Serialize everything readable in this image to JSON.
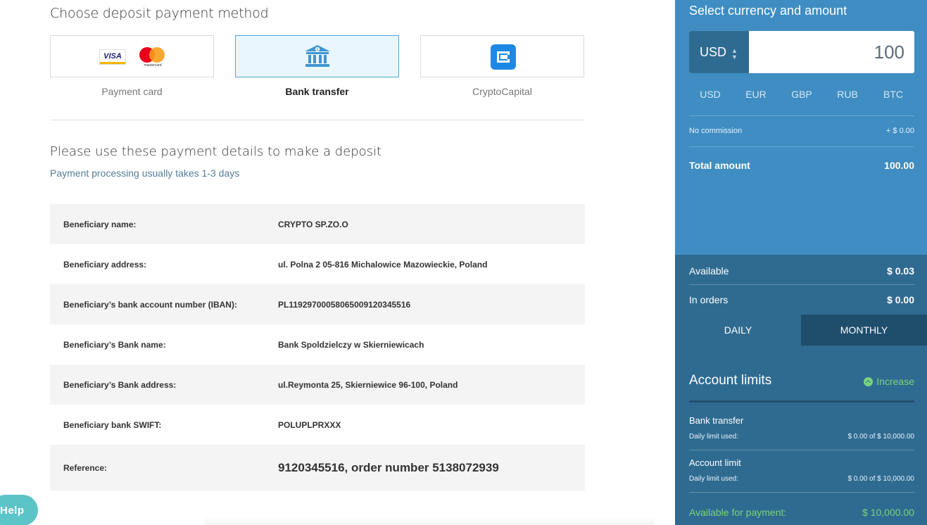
{
  "deposit": {
    "section_title": "Choose deposit payment method",
    "methods": [
      {
        "label": "Payment card",
        "icon": "card-brands-icon"
      },
      {
        "label": "Bank transfer",
        "icon": "bank-icon"
      },
      {
        "label": "CryptoCapital",
        "icon": "cryptocapital-icon"
      }
    ],
    "card_brands": {
      "visa": "VISA",
      "mastercard": "mastercard"
    },
    "selected_method": "Bank transfer"
  },
  "details": {
    "title": "Please use these payment details to make a deposit",
    "subtitle": "Payment processing usually takes 1-3 days",
    "rows": [
      {
        "key": "Beneficiary name:",
        "value": "CRYPTO SP.ZO.O"
      },
      {
        "key": "Beneficiary address:",
        "value": "ul. Polna 2 05-816 Michalowice Mazowieckie, Poland"
      },
      {
        "key": "Beneficiary’s bank account number (IBAN):",
        "value": "PL11929700058065009120345516"
      },
      {
        "key": "Beneficiary’s Bank name:",
        "value": "Bank Spoldzielczy w Skierniewicach"
      },
      {
        "key": "Beneficiary’s Bank address:",
        "value": "ul.Reymonta 25, Skierniewice 96-100, Poland"
      },
      {
        "key": "Beneficiary bank SWIFT:",
        "value": "POLUPLPRXXX"
      },
      {
        "key": "Reference:",
        "value": "9120345516, order number 5138072939"
      }
    ]
  },
  "help": {
    "label": "Help"
  },
  "sidebar": {
    "title": "Select currency and amount",
    "currency_select": "USD",
    "amount_value": "100",
    "currencies": [
      "USD",
      "EUR",
      "GBP",
      "RUB",
      "BTC"
    ],
    "commission": {
      "label": "No commission",
      "value": "+ $ 0.00"
    },
    "total": {
      "label": "Total amount",
      "value": "100.00"
    },
    "available": {
      "label": "Available",
      "value": "$ 0.03"
    },
    "in_orders": {
      "label": "In orders",
      "value": "$ 0.00"
    },
    "period_tabs": {
      "daily": "DAILY",
      "monthly": "MONTHLY"
    },
    "limits": {
      "title": "Account limits",
      "increase": "Increase",
      "items": [
        {
          "name": "Bank transfer",
          "used_label": "Daily limit used:",
          "used_value": "$ 0.00 of $ 10,000.00"
        },
        {
          "name": "Account limit",
          "used_label": "Daily limit used:",
          "used_value": "$ 0.00 of $ 10,000.00"
        }
      ],
      "available_for_payment": {
        "label": "Available for payment:",
        "value": "$ 10,000.00"
      }
    },
    "colors": {
      "panel": "#3f8dc2",
      "panel_dark": "#2f6b91",
      "accent_green": "#7ad27c"
    }
  }
}
